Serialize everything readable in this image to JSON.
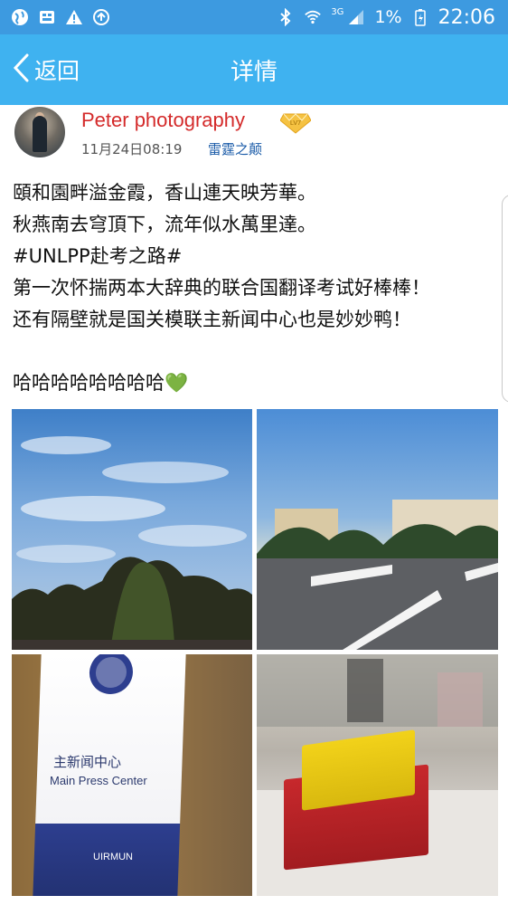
{
  "status_bar": {
    "icons": [
      "globe-icon",
      "image-icon",
      "warning-icon",
      "sync-icon",
      "bluetooth-icon",
      "wifi-icon",
      "signal-icon",
      "battery-icon"
    ],
    "network": "3G",
    "battery": "1%",
    "time": "22:06"
  },
  "nav": {
    "back_label": "返回",
    "title": "详情"
  },
  "post": {
    "username": "Peter photography",
    "vip_badge": "LV7",
    "time": "11月24日08:19",
    "source": "雷霆之颠",
    "lines": [
      "頤和園畔溢金霞，香山連天映芳華。",
      "秋燕南去穹頂下，流年似水萬里達。",
      "#UNLPP赴考之路#",
      "第一次怀揣两本大辞典的联合国翻译考试好棒棒！",
      "还有隔壁就是国关模联主新闻中心也是妙妙鸭！",
      "",
      "哈哈哈哈哈哈哈哈💚"
    ]
  },
  "photos": {
    "banner_zh": "主新闻中心",
    "banner_en": "Main Press Center",
    "banner_logo": "UIRMUN"
  },
  "colors": {
    "status_bar": "#3d9ae0",
    "nav_bar": "#3fb2f0",
    "username": "#d42a2a",
    "source": "#1a5ba8"
  }
}
